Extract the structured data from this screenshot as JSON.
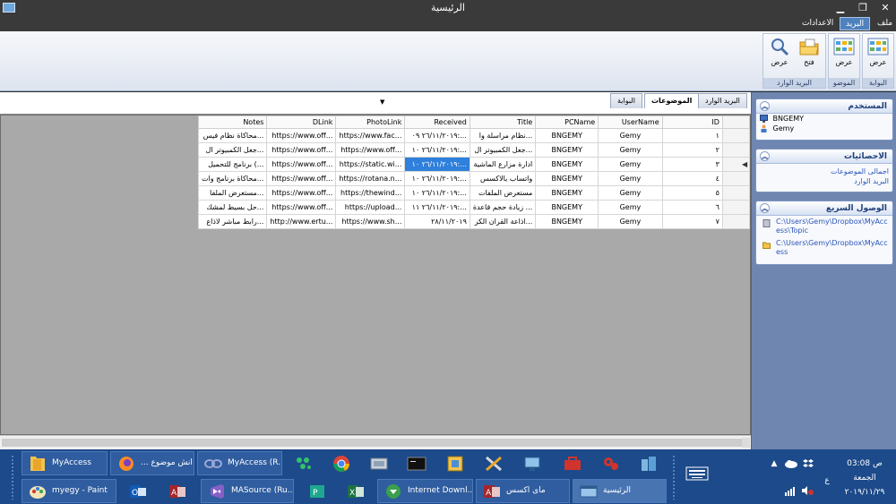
{
  "window": {
    "title": "الرئيسية"
  },
  "menu": {
    "file": "ملف",
    "mail": "البريد",
    "settings": "الاعدادات"
  },
  "ribbon": {
    "groups": [
      {
        "label": "البوابة",
        "buttons": [
          "عرض"
        ]
      },
      {
        "label": "الموضو",
        "buttons": [
          "عرض"
        ]
      },
      {
        "label": "البريد الوارد",
        "buttons": [
          "فتح",
          "عرض"
        ]
      }
    ]
  },
  "tabs": [
    "البريد الوارد",
    "الموضوعات",
    "البوابة"
  ],
  "grid": {
    "columns": [
      "ID",
      "UserName",
      "PCName",
      "Title",
      "Received",
      "PhotoLink",
      "DLink",
      "Notes"
    ],
    "rows": [
      [
        "١",
        "Gemy",
        "BNGEMY",
        "نظام مراسلة وا...",
        "٢٦/١١/٢٠١٩ ٠٩:...",
        "https://www.fac...",
        "https://www.off...",
        "محاكاة نظام فيس..."
      ],
      [
        "٢",
        "Gemy",
        "BNGEMY",
        "جعل الكمبيوتر ال...",
        "٢٦/١١/٢٠١٩ ١٠:...",
        "https://www.off...",
        "https://www.off...",
        "جعل الكمبيوتر ال..."
      ],
      [
        "٣",
        "Gemy",
        "BNGEMY",
        "ادارة مزارع الماشية",
        "٢٦/١١/٢٠١٩ ١٠:...",
        "https://static.wi...",
        "https://www.off...",
        "برنامج للتحميل (..."
      ],
      [
        "٤",
        "Gemy",
        "BNGEMY",
        "واتساب بالاكسس",
        "٢٦/١١/٢٠١٩ ١٠:...",
        "https://rotana.n...",
        "https://www.off...",
        "محاكاة برنامج وات..."
      ],
      [
        "٥",
        "Gemy",
        "BNGEMY",
        "مستعرض الملفات",
        "٢٦/١١/٢٠١٩ ١٠:...",
        "https://thewind...",
        "https://www.off...",
        "مستعرض الملفا..."
      ],
      [
        "٦",
        "Gemy",
        "BNGEMY",
        "زيادة حجم قاعدة ...",
        "٢٦/١١/٢٠١٩ ١١:...",
        "https://upload...",
        "https://www.off...",
        "حل بسيط لمشك..."
      ],
      [
        "٧",
        "Gemy",
        "BNGEMY",
        "اذاعة القران الكر...",
        "٢٨/١١/٢٠١٩",
        "https://www.sh...",
        "http://www.ertu...",
        "رابط مباشر لاذاع..."
      ]
    ]
  },
  "panel": {
    "user": {
      "title": "المستخدم",
      "items": [
        "BNGEMY",
        "Gemy"
      ]
    },
    "stats": {
      "title": "الاحصائيات",
      "items": [
        "اجمالى الموضوعات",
        "البريد الوارد"
      ]
    },
    "quick": {
      "title": "الوصول السريع",
      "items": [
        "C:\\Users\\Gemy\\Dropbox\\MyAccess\\Topic",
        "C:\\Users\\Gemy\\Dropbox\\MyAccess"
      ]
    }
  },
  "taskbar": {
    "items": [
      "MyAccess",
      "... انش موضوع",
      "MyAccess (R...",
      "myegy - Paint",
      "MASource (Ru...",
      "Internet Downl...",
      "ماى اكسس",
      "الرئيسية"
    ],
    "time": "ص 03:08",
    "day": "الجمعة",
    "date": "٢٠١٩/١١/٢٩",
    "lang": "ع"
  }
}
